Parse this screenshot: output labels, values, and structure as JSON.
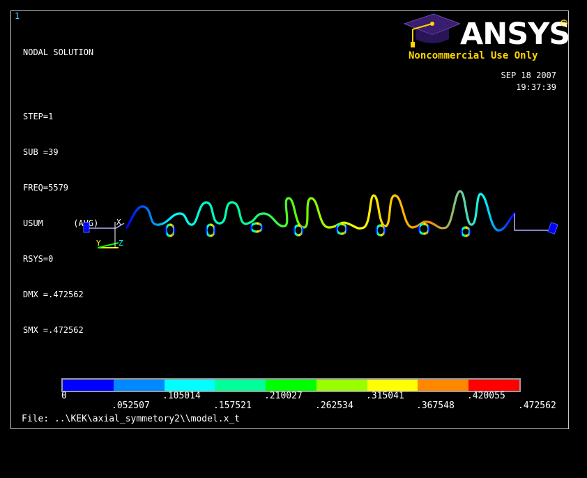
{
  "window_number": "1",
  "header": {
    "title": "NODAL SOLUTION",
    "info_lines": [
      "STEP=1",
      "SUB =39",
      "FREQ=5579",
      "USUM      (AVG)",
      "RSYS=0",
      "DMX =.472562",
      "SMX =.472562"
    ]
  },
  "logo": {
    "brand": "ANSYS",
    "reg_mark": "R",
    "subtitle": "Noncommercial Use Only",
    "accent_color": "#ffd700",
    "cap_color": "#3a1d6e"
  },
  "timestamp": {
    "date": "SEP 18 2007",
    "time": "19:37:39"
  },
  "triad": {
    "labels": [
      "X",
      "Y",
      "Z"
    ]
  },
  "legend": {
    "colors": [
      "#0000ff",
      "#0088ff",
      "#00ffff",
      "#00ff99",
      "#00ff00",
      "#99ff00",
      "#ffff00",
      "#ff8800",
      "#ff0000"
    ],
    "upper_ticks": [
      "0",
      ".105014",
      ".210027",
      ".315041",
      ".420055"
    ],
    "lower_ticks": [
      ".052507",
      ".157521",
      ".262534",
      ".367548",
      ".472562"
    ]
  },
  "file_label": "File: ..\\KEK\\axial_symmetory2\\\\model.x_t"
}
